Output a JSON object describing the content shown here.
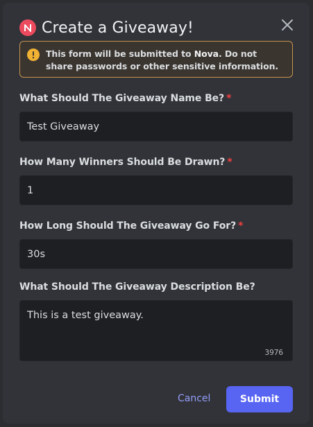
{
  "modal": {
    "title": "Create a Giveaway!",
    "notice": {
      "prefix": "This form will be submitted to ",
      "app_name": "Nova",
      "suffix": ". Do not share passwords or other sensitive information."
    },
    "fields": [
      {
        "label": "What Should The Giveaway Name Be?",
        "required_mark": "*",
        "value": "Test Giveaway"
      },
      {
        "label": "How Many Winners Should Be Drawn?",
        "required_mark": "*",
        "value": "1"
      },
      {
        "label": "How Long Should The Giveaway Go For?",
        "required_mark": "*",
        "value": "30s"
      },
      {
        "label": "What Should The Giveaway Description Be?",
        "value": "This is a test giveaway.",
        "char_count": "3976"
      }
    ],
    "cancel_label": "Cancel",
    "submit_label": "Submit"
  },
  "colors": {
    "background": "#313338",
    "input_bg": "#1e1f22",
    "accent": "#5865f2",
    "link": "#949cf7",
    "required": "#f23f43",
    "warning": "#f0b232",
    "app_icon": "#ec4a5e"
  },
  "icons": {
    "app": "app-logo-icon",
    "warning": "warning-circle-icon",
    "close": "close-icon"
  }
}
